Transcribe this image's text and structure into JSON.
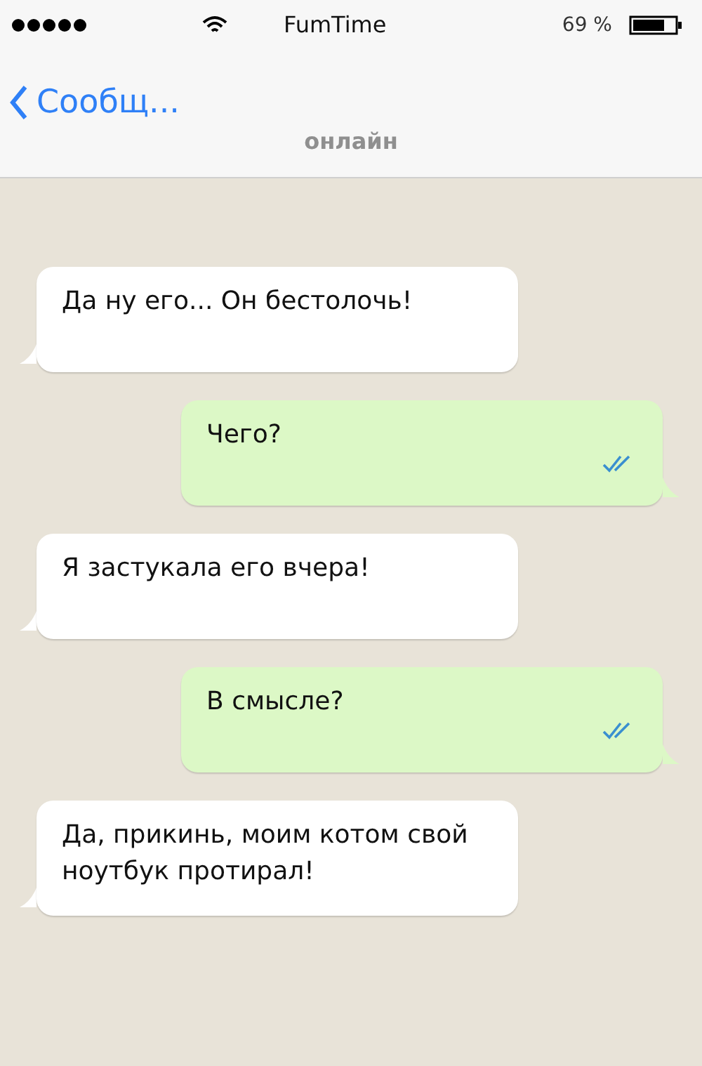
{
  "status_bar": {
    "carrier": "FumTime",
    "battery": "69 %"
  },
  "nav": {
    "back": "Сообщ...",
    "subtitle": "онлайн"
  },
  "messages": [
    {
      "kind": "incoming",
      "text": "Да ну его... Он бестолочь!"
    },
    {
      "kind": "outgoing",
      "text": "Чего?",
      "read": true
    },
    {
      "kind": "incoming",
      "text": "Я застукала его вчера!"
    },
    {
      "kind": "outgoing",
      "text": "В смысле?",
      "read": true
    },
    {
      "kind": "incoming",
      "text": "Да, прикинь, моим котом свой ноутбук протирал!"
    }
  ]
}
